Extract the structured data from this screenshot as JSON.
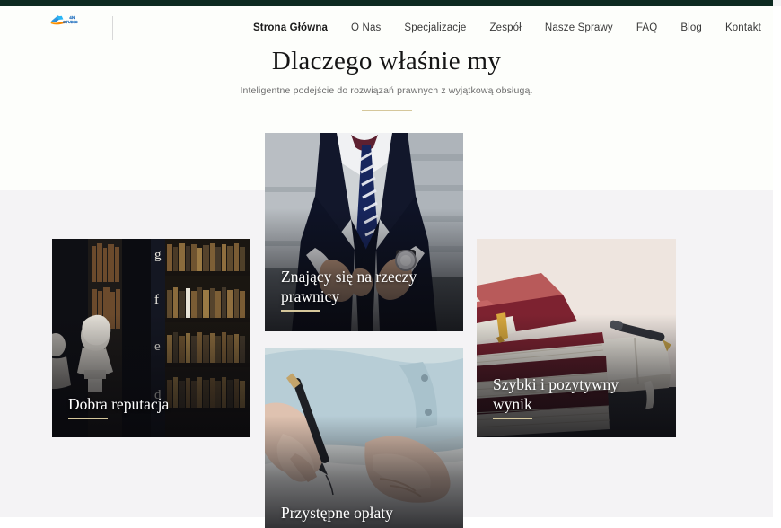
{
  "site": {
    "logo_text_top": "4N",
    "logo_text_bottom": "STUDIO",
    "logo_name": "4N STUDIO"
  },
  "theme": {
    "topbar_color": "#0d2a21",
    "gold_accent": "#d5c79b",
    "hero_bg": "#fdfefb",
    "section_bg": "#f4f3f5",
    "text_dark": "#151515"
  },
  "nav": {
    "items": [
      {
        "label": "Strona Główna",
        "active": true
      },
      {
        "label": "O Nas",
        "active": false
      },
      {
        "label": "Specjalizacje",
        "active": false
      },
      {
        "label": "Zespół",
        "active": false
      },
      {
        "label": "Nasze Sprawy",
        "active": false
      },
      {
        "label": "FAQ",
        "active": false
      },
      {
        "label": "Blog",
        "active": false
      },
      {
        "label": "Kontakt",
        "active": false
      }
    ]
  },
  "hero": {
    "title": "Dlaczego właśnie my",
    "subtitle": "Inteligentne podejście do rozwiązań prawnych z wyjątkową obsługą."
  },
  "cards": {
    "left": {
      "title": "Dobra reputacja",
      "image": "library-busts-bookshelves-photo"
    },
    "center": {
      "title": "Znający się na rzeczy prawnicy",
      "image": "businessman-suit-tie-photo"
    },
    "right": {
      "title": "Szybki i pozytywny wynik",
      "image": "stacked-law-books-pen-photo"
    },
    "bottom": {
      "title": "Przystępne opłaty",
      "image": "hand-writing-document-photo"
    }
  }
}
